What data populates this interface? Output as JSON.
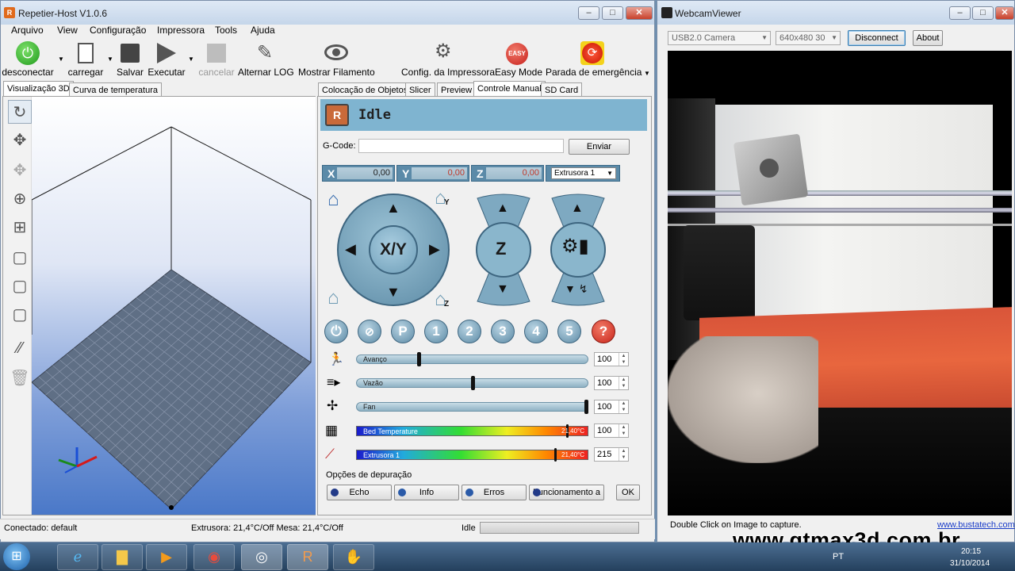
{
  "main_window": {
    "title": "Repetier-Host V1.0.6",
    "menu": [
      "Arquivo",
      "View",
      "Configuração",
      "Impressora",
      "Tools",
      "Ajuda"
    ],
    "toolbar": {
      "disconnect": "desconectar",
      "load": "carregar",
      "save": "Salvar",
      "run": "Executar",
      "cancel": "cancelar",
      "toggle_log": "Alternar LOG",
      "show_filament": "Mostrar Filamento",
      "printer_config": "Config. da Impressora",
      "easy_mode": "Easy Mode",
      "emergency_stop": "Parada de emergência",
      "easy_badge": "EASY"
    },
    "left_tabs": [
      "Visualização 3D",
      "Curva de temperatura"
    ],
    "right_tabs": [
      "Colocação de Objetos",
      "Slicer",
      "Preview",
      "Controle Manual",
      "SD Card"
    ],
    "manual": {
      "status": "Idle",
      "gcode_label": "G-Code:",
      "gcode_value": "",
      "send_label": "Enviar",
      "x_label": "X",
      "x_value": "0,00",
      "y_label": "Y",
      "y_value": "0,00",
      "z_label": "Z",
      "z_value": "0,00",
      "extruder_select": "Extrusora 1",
      "xy_label": "X/Y",
      "z_pad_label": "Z",
      "home_y_label": "Y",
      "home_z_label": "Z",
      "fn_buttons": [
        "P",
        "1",
        "2",
        "3",
        "4",
        "5",
        "?"
      ],
      "sliders": [
        {
          "label": "Avanço",
          "value": "100",
          "pos": 0.27
        },
        {
          "label": "Vazão",
          "value": "100",
          "pos": 0.5
        },
        {
          "label": "Fan",
          "value": "100",
          "pos": 1.0
        }
      ],
      "bed": {
        "label": "Bed Temperature",
        "reading": "21,40°C",
        "value": "100",
        "target": 0.9
      },
      "extruder": {
        "label": "Extrusora 1",
        "reading": "21,40°C",
        "value": "215",
        "target": 0.85
      },
      "debug_label": "Opções de depuração",
      "debug_buttons": [
        "Echo",
        "Info",
        "Erros",
        "Funcionamento a"
      ],
      "ok_label": "OK"
    },
    "statusbar": {
      "connected": "Conectado: default",
      "temps": "Extrusora: 21,4°C/Off Mesa: 21,4°C/Off",
      "state": "Idle"
    }
  },
  "webcam_window": {
    "title": "WebcamViewer",
    "device": "USB2.0 Camera",
    "resolution": "640x480 30",
    "disconnect_label": "Disconnect",
    "about_label": "About",
    "hint": "Double Click on Image to capture.",
    "link": "www.bustatech.com"
  },
  "watermark": "www.gtmax3d.com.br",
  "taskbar": {
    "lang": "PT",
    "time": "20:15",
    "date": "31/10/2014"
  },
  "colors": {
    "accent": "#7fb4d0",
    "pad": "#6d9ab3",
    "grid": "#5f6f85",
    "scene_bg_top": "#ffffff",
    "scene_bg_bottom": "#4a78c8"
  }
}
